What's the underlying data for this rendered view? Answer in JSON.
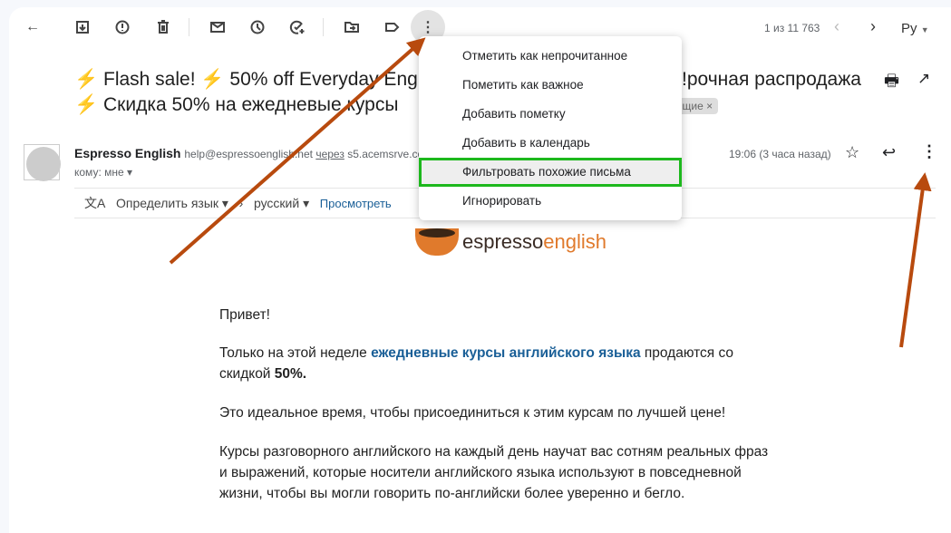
{
  "toolbar": {
    "back": "back",
    "archive": "archive",
    "spam": "report-spam",
    "delete": "delete",
    "unread": "mark-unread",
    "snooze": "snooze",
    "task": "add-task",
    "move": "move-to",
    "label": "label",
    "more": "more",
    "counter": "1 из 11 763",
    "lang": "Ру"
  },
  "subject": {
    "line1_a": "Flash sale!",
    "line1_b": "50% off Everyday Eng",
    "line1_c": "рочная распродажа!",
    "line2": "Скидка 50% на ежедневые курсы",
    "label_chip": "ящие"
  },
  "sender": {
    "name": "Espresso English",
    "email": "help@espressoenglish.net",
    "via": "через",
    "via_domain": "s5.acemsrve.com",
    "to": "кому: мне",
    "time": "19:06 (3 часа назад)"
  },
  "translate": {
    "detect": "Определить язык",
    "target": "русский",
    "view": "Просмотреть"
  },
  "menu": {
    "items": [
      "Отметить как непрочитанное",
      "Пометить как важное",
      "Добавить пометку",
      "Добавить в календарь",
      "Фильтровать похожие письма",
      "Игнорировать"
    ]
  },
  "logo": {
    "part1": "espresso",
    "part2": "english"
  },
  "body": {
    "greeting": "Привет!",
    "p1_a": "Только на этой неделе ",
    "p1_link": "ежедневные курсы английского языка",
    "p1_b": " продаются со скидкой ",
    "p1_c": "50%.",
    "p2": "Это идеальное время, чтобы присоединиться к этим курсам по лучшей цене!",
    "p3": "Курсы разговорного английского на каждый день научат вас сотням реальных фраз и выражений, которые носители английского языка используют в повседневной жизни, чтобы вы могли говорить по-английски более уверенно и бегло."
  },
  "colors": {
    "highlight": "#1db81d",
    "arrow": "#b84a0e",
    "link": "#1a5f97"
  }
}
